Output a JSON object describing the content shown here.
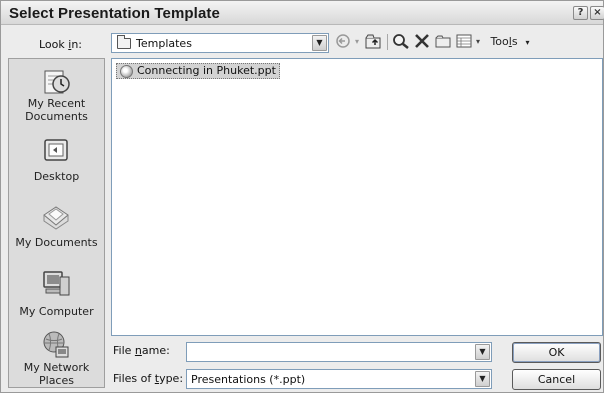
{
  "window": {
    "title": "Select Presentation Template",
    "help_button": "?",
    "close_button": "×"
  },
  "lookin": {
    "label_pre": "Look ",
    "label_mnemonic": "i",
    "label_post": "n:",
    "value": "Templates"
  },
  "toolbar": {
    "tools_label_pre": "Too",
    "tools_label_mnemonic": "l",
    "tools_label_post": "s",
    "icons": [
      "back-icon",
      "up-one-level-icon",
      "search-web-icon",
      "delete-icon",
      "new-folder-icon",
      "views-icon",
      "tools-dropdown-icon"
    ]
  },
  "places": [
    {
      "label": "My Recent Documents",
      "icon": "recent-documents-icon"
    },
    {
      "label": "Desktop",
      "icon": "desktop-icon"
    },
    {
      "label": "My Documents",
      "icon": "my-documents-icon"
    },
    {
      "label": "My Computer",
      "icon": "my-computer-icon"
    },
    {
      "label": "My Network Places",
      "icon": "network-places-icon"
    }
  ],
  "files": [
    {
      "name": "Connecting in Phuket.ppt",
      "selected": true
    }
  ],
  "filename": {
    "label_pre": "File ",
    "label_mnemonic": "n",
    "label_post": "ame:",
    "value": ""
  },
  "filetype": {
    "label_pre": "Files of ",
    "label_mnemonic": "t",
    "label_post": "ype:",
    "value": "Presentations (*.ppt)"
  },
  "buttons": {
    "ok": "OK",
    "cancel": "Cancel"
  }
}
